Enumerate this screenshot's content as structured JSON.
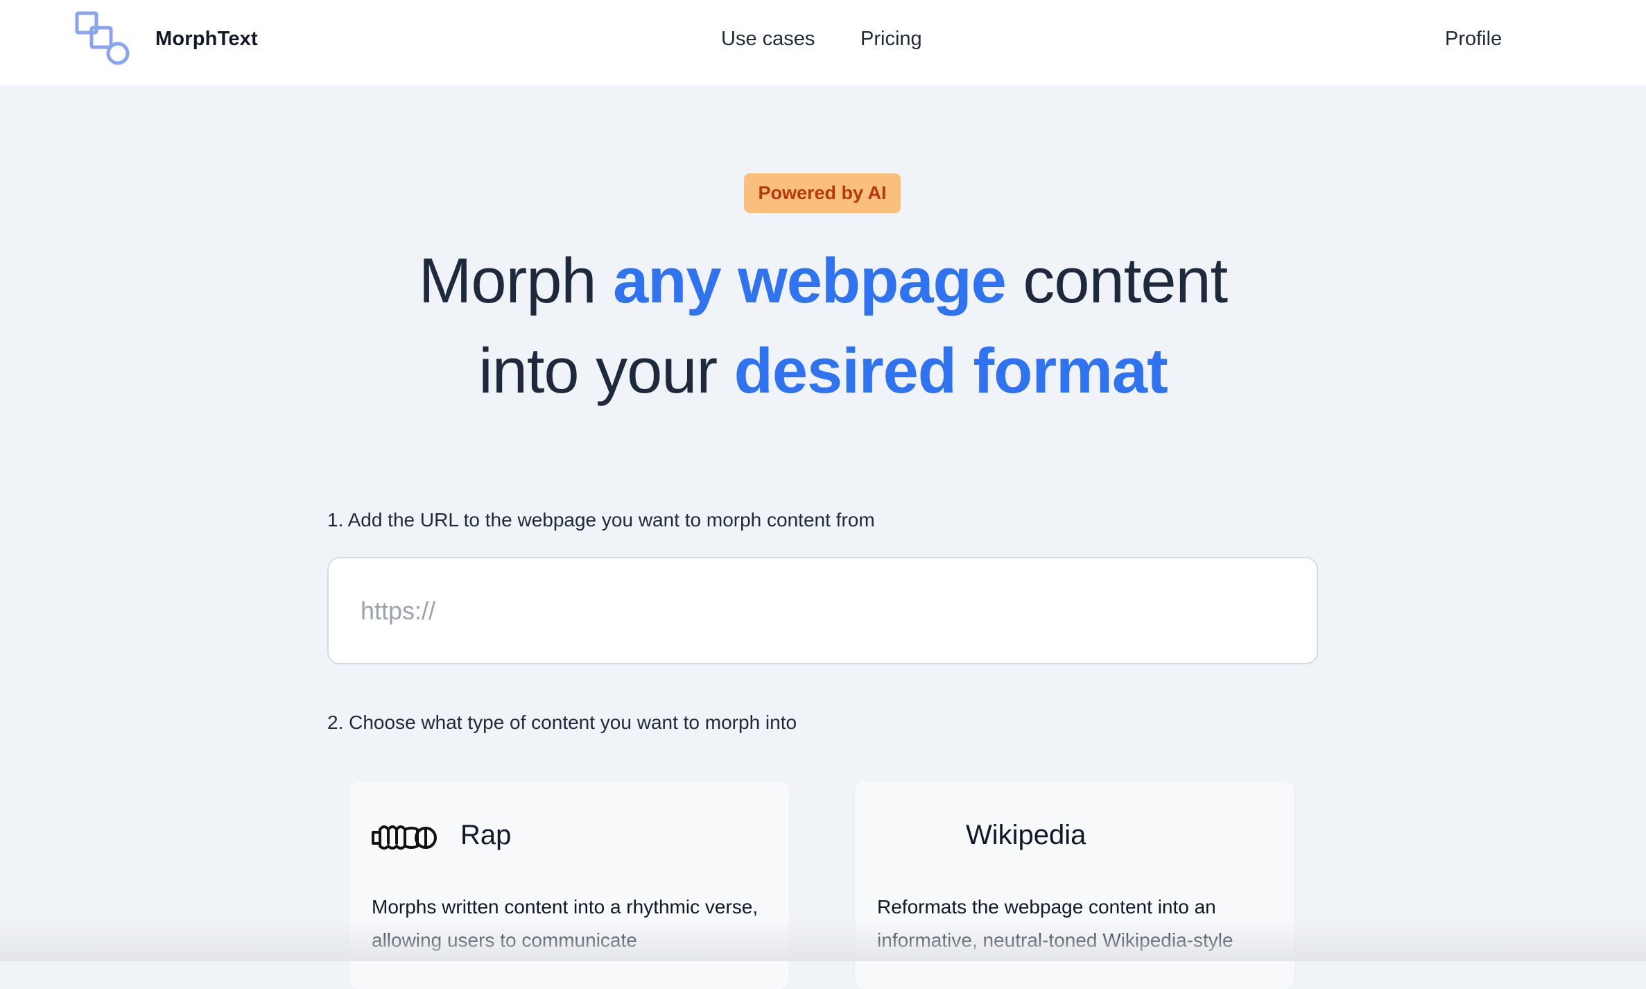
{
  "brand": {
    "name": "MorphText",
    "logo_icon": "squares-circle-logo-icon"
  },
  "nav": {
    "use_cases": "Use cases",
    "pricing": "Pricing",
    "profile": "Profile"
  },
  "hero": {
    "badge": "Powered by AI",
    "line1_a": "Morph ",
    "line1_accent": "any webpage",
    "line1_b": " content",
    "line2_a": "into your ",
    "line2_accent": "desired format"
  },
  "steps": {
    "step1_label": "1. Add the URL to the webpage you want to morph content from",
    "url_placeholder": "https://",
    "url_value": "",
    "step2_label": "2. Choose what type of content you want to morph into"
  },
  "cards": [
    {
      "title": "Rap",
      "icon": "microphone-icon",
      "description": "Morphs written content into a rhythmic verse, allowing users to communicate"
    },
    {
      "title": "Wikipedia",
      "icon": "",
      "description": "Reformats the webpage content into an informative, neutral-toned Wikipedia-style"
    }
  ],
  "colors": {
    "accent": "#2f73f0",
    "badge_bg": "#fbbf7d",
    "badge_text": "#b23a0d",
    "page_bg": "#f0f3f8",
    "heading": "#1e293b"
  }
}
